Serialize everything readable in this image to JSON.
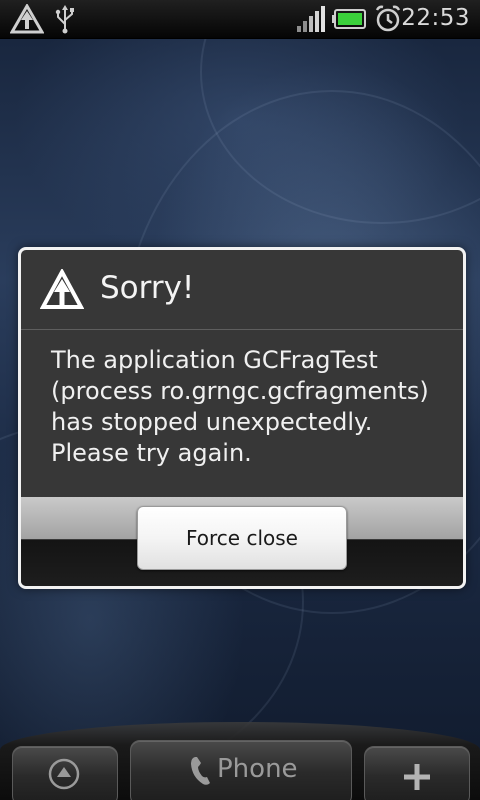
{
  "status_bar": {
    "icons": [
      "alert-icon",
      "usb-icon",
      "signal-icon",
      "battery-icon",
      "alarm-icon"
    ],
    "time": "22:53"
  },
  "dialog": {
    "icon": "alert-icon",
    "title": "Sorry!",
    "message": "The application GCFragTest\n(process ro.grngc.gcfragments)\nhas stopped unexpectedly.\nPlease try again.",
    "button_label": "Force close"
  },
  "dock": {
    "left_icon": "up-arrow-icon",
    "phone_label": "Phone",
    "phone_icon": "phone-icon",
    "right_icon": "plus-icon"
  },
  "colors": {
    "battery": "#3bd13b",
    "dialog_bg": "#373737",
    "dialog_border": "#f2f2f2"
  }
}
